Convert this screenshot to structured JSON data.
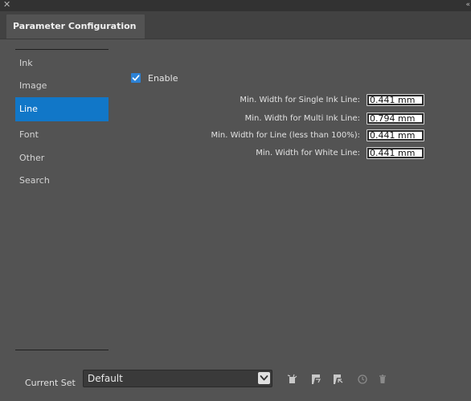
{
  "panel": {
    "title": "Parameter Configuration"
  },
  "sidebar": {
    "items": [
      {
        "label": "Ink",
        "active": false
      },
      {
        "label": "Image",
        "active": false
      },
      {
        "label": "Line",
        "active": true
      },
      {
        "label": "Font",
        "active": false
      },
      {
        "label": "Other",
        "active": false
      },
      {
        "label": "Search",
        "active": false
      }
    ]
  },
  "line": {
    "enable": {
      "label": "Enable",
      "checked": true
    },
    "params": [
      {
        "label": "Min. Width for Single Ink Line:",
        "value": "0.441 mm"
      },
      {
        "label": "Min. Width for Multi Ink Line:",
        "value": "0.794 mm"
      },
      {
        "label": "Min. Width for Line (less than 100%):",
        "value": "0.441 mm"
      },
      {
        "label": "Min. Width for White Line:",
        "value": "0.441 mm"
      }
    ]
  },
  "footer": {
    "current_set_label": "Current Set",
    "current_set_value": "Default",
    "icons": [
      "new-set-icon",
      "save-set-icon",
      "save-as-set-icon",
      "reset-set-icon",
      "delete-set-icon"
    ]
  },
  "colors": {
    "panel_bg": "#535353",
    "accent": "#1177c8",
    "checkbox": "#2c82d6"
  }
}
